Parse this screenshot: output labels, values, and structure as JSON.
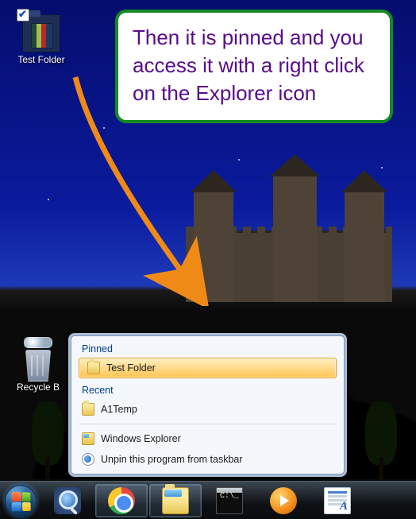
{
  "callout": {
    "text": "Then it is pinned and you access it with a right click on the Explorer icon"
  },
  "desktop_icons": {
    "test_folder": "Test Folder",
    "recycle_bin": "Recycle B"
  },
  "jumplist": {
    "pinned_header": "Pinned",
    "recent_header": "Recent",
    "pinned_items": [
      {
        "label": "Test Folder"
      }
    ],
    "recent_items": [
      {
        "label": "A1Temp"
      }
    ],
    "app_label": "Windows Explorer",
    "unpin_label": "Unpin this program from taskbar"
  },
  "taskbar": {
    "items": [
      {
        "name": "start"
      },
      {
        "name": "magnifier"
      },
      {
        "name": "chrome"
      },
      {
        "name": "explorer"
      },
      {
        "name": "cmd"
      },
      {
        "name": "wmp"
      },
      {
        "name": "wordpad"
      }
    ]
  },
  "colors": {
    "callout_border": "#148b21",
    "callout_text": "#580c8a",
    "arrow": "#f08a17"
  }
}
